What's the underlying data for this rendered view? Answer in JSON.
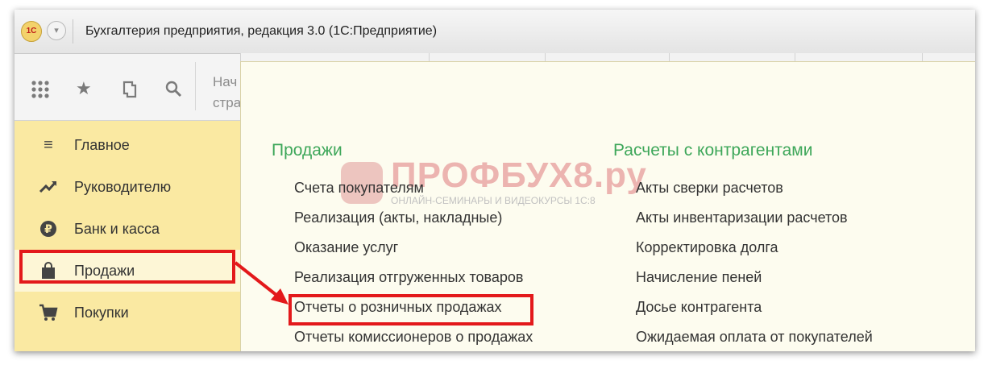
{
  "window": {
    "app_badge": "1С",
    "title": "Бухгалтерия предприятия, редакция 3.0  (1С:Предприятие)"
  },
  "toolbar": {
    "icons": [
      "apps-grid-icon",
      "star-icon",
      "history-icon",
      "search-icon"
    ],
    "tab_text": [
      "Нач",
      "стра"
    ]
  },
  "sidebar": {
    "items": [
      {
        "label": "Главное",
        "icon": "menu-lines-icon"
      },
      {
        "label": "Руководителю",
        "icon": "trend-chart-icon"
      },
      {
        "label": "Банк и касса",
        "icon": "ruble-coin-icon"
      },
      {
        "label": "Продажи",
        "icon": "shopping-bag-icon",
        "selected": true
      },
      {
        "label": "Покупки",
        "icon": "shopping-cart-icon"
      }
    ]
  },
  "panel": {
    "groups": [
      {
        "title": "Продажи",
        "links": [
          "Счета покупателям",
          "Реализация (акты, накладные)",
          "Оказание услуг",
          "Реализация отгруженных товаров",
          "Отчеты о розничных продажах",
          "Отчеты комиссионеров о продажах"
        ]
      },
      {
        "title": "Расчеты с контрагентами",
        "links": [
          "Акты сверки расчетов",
          "Акты инвентаризации расчетов",
          "Корректировка долга",
          "Начисление пеней",
          "Досье контрагента",
          "Ожидаемая оплата от покупателей"
        ]
      }
    ]
  },
  "watermark": {
    "title": "ПРОФБУХ8.ру",
    "subtitle": "ОНЛАЙН-СЕМИНАРЫ И ВИДЕОКУРСЫ 1С:8"
  },
  "colors": {
    "sidebar_bg": "#fae9a2",
    "panel_bg": "#fdfcef",
    "group_title": "#3ea75a",
    "highlight": "#e3191b"
  }
}
